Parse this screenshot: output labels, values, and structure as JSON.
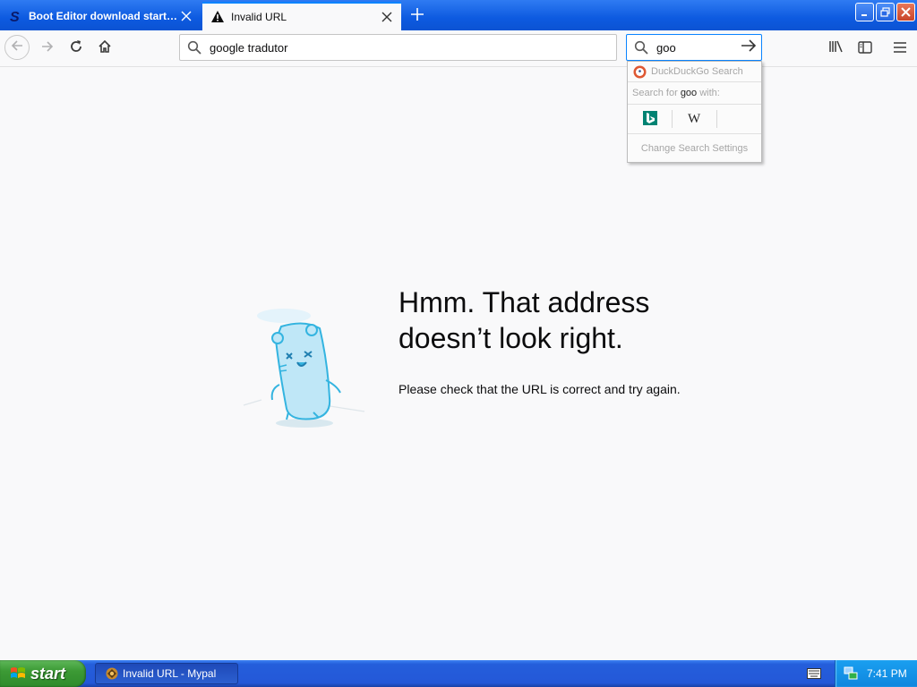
{
  "tabs": [
    {
      "title": "Boot Editor download starting...",
      "favicon": "softonic-s-icon",
      "active": false
    },
    {
      "title": "Invalid URL",
      "favicon": "warning-triangle-icon",
      "active": true
    }
  ],
  "navbar": {
    "url_value": "google tradutor",
    "search_value": "goo"
  },
  "search_popup": {
    "default_engine": "DuckDuckGo Search",
    "search_for_prefix": "Search for ",
    "search_term": "goo",
    "search_for_suffix": " with:",
    "engines": [
      "bing-icon",
      "wikipedia-icon"
    ],
    "settings_label": "Change Search Settings"
  },
  "error": {
    "title": "Hmm. That address doesn’t look right.",
    "description": "Please check that the URL is correct and try again."
  },
  "taskbar": {
    "start_label": "start",
    "task_label": "Invalid URL - Mypal",
    "clock": "7:41 PM"
  },
  "colors": {
    "accent": "#0a84ff",
    "titlebar": "#0d5ae0",
    "taskbar": "#245edb",
    "start": "#3c9a35"
  }
}
